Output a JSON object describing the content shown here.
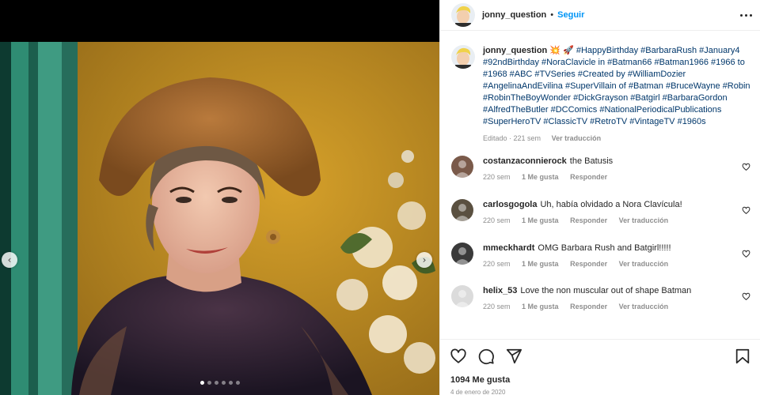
{
  "post": {
    "username": "jonny_question",
    "separator": "•",
    "follow_label": "Seguir",
    "more_icon": "more-horizontal-icon",
    "avatar_icon": "avatar-cartoon-boy"
  },
  "media": {
    "prev_icon": "‹",
    "next_icon": "›",
    "dots_count": 6,
    "active_dot": 0
  },
  "caption": {
    "username": "jonny_question",
    "emoji": "💥 🚀",
    "text": "#HappyBirthday #BarbaraRush #January4 #92ndBirthday #NoraClavicle in #Batman66 #Batman1966 #1966 to #1968 #ABC #TVSeries #Created by #WilliamDozier #AngelinaAndEvilina #SuperVillain of #Batman #BruceWayne #Robin #RobinTheBoyWonder #DickGrayson #Batgirl #BarbaraGordon #AlfredTheButler #DCComics #NationalPeriodicalPublications #SuperHeroTV #ClassicTV #RetroTV #VintageTV #1960s",
    "edited": "Editado · 221 sem",
    "translate": "Ver traducción"
  },
  "comments": [
    {
      "user": "costanzaconnierock",
      "text": "the Batusis",
      "time": "220 sem",
      "likes": "1 Me gusta",
      "reply": "Responder",
      "translate": "",
      "avatar_color": "#7a5a4a"
    },
    {
      "user": "carlosgogola",
      "text": "Uh, había olvidado a Nora Clavícula!",
      "time": "220 sem",
      "likes": "1 Me gusta",
      "reply": "Responder",
      "translate": "Ver traducción",
      "avatar_color": "#5a5040"
    },
    {
      "user": "mmeckhardt",
      "text": "OMG Barbara Rush and Batgirl!!!!!",
      "time": "220 sem",
      "likes": "1 Me gusta",
      "reply": "Responder",
      "translate": "Ver traducción",
      "avatar_color": "#3a3a3a"
    },
    {
      "user": "helix_53",
      "text": "Love the non muscular out of shape Batman",
      "time": "220 sem",
      "likes": "1 Me gusta",
      "reply": "Responder",
      "translate": "Ver traducción",
      "avatar_color": "#dbdbdb"
    }
  ],
  "actions": {
    "likes_label": "1094 Me gusta",
    "date_label": "4 de enero de 2020"
  },
  "colors": {
    "accent": "#0095f6",
    "hashtag": "#00376b",
    "muted": "#8e8e8e",
    "text": "#262626"
  }
}
